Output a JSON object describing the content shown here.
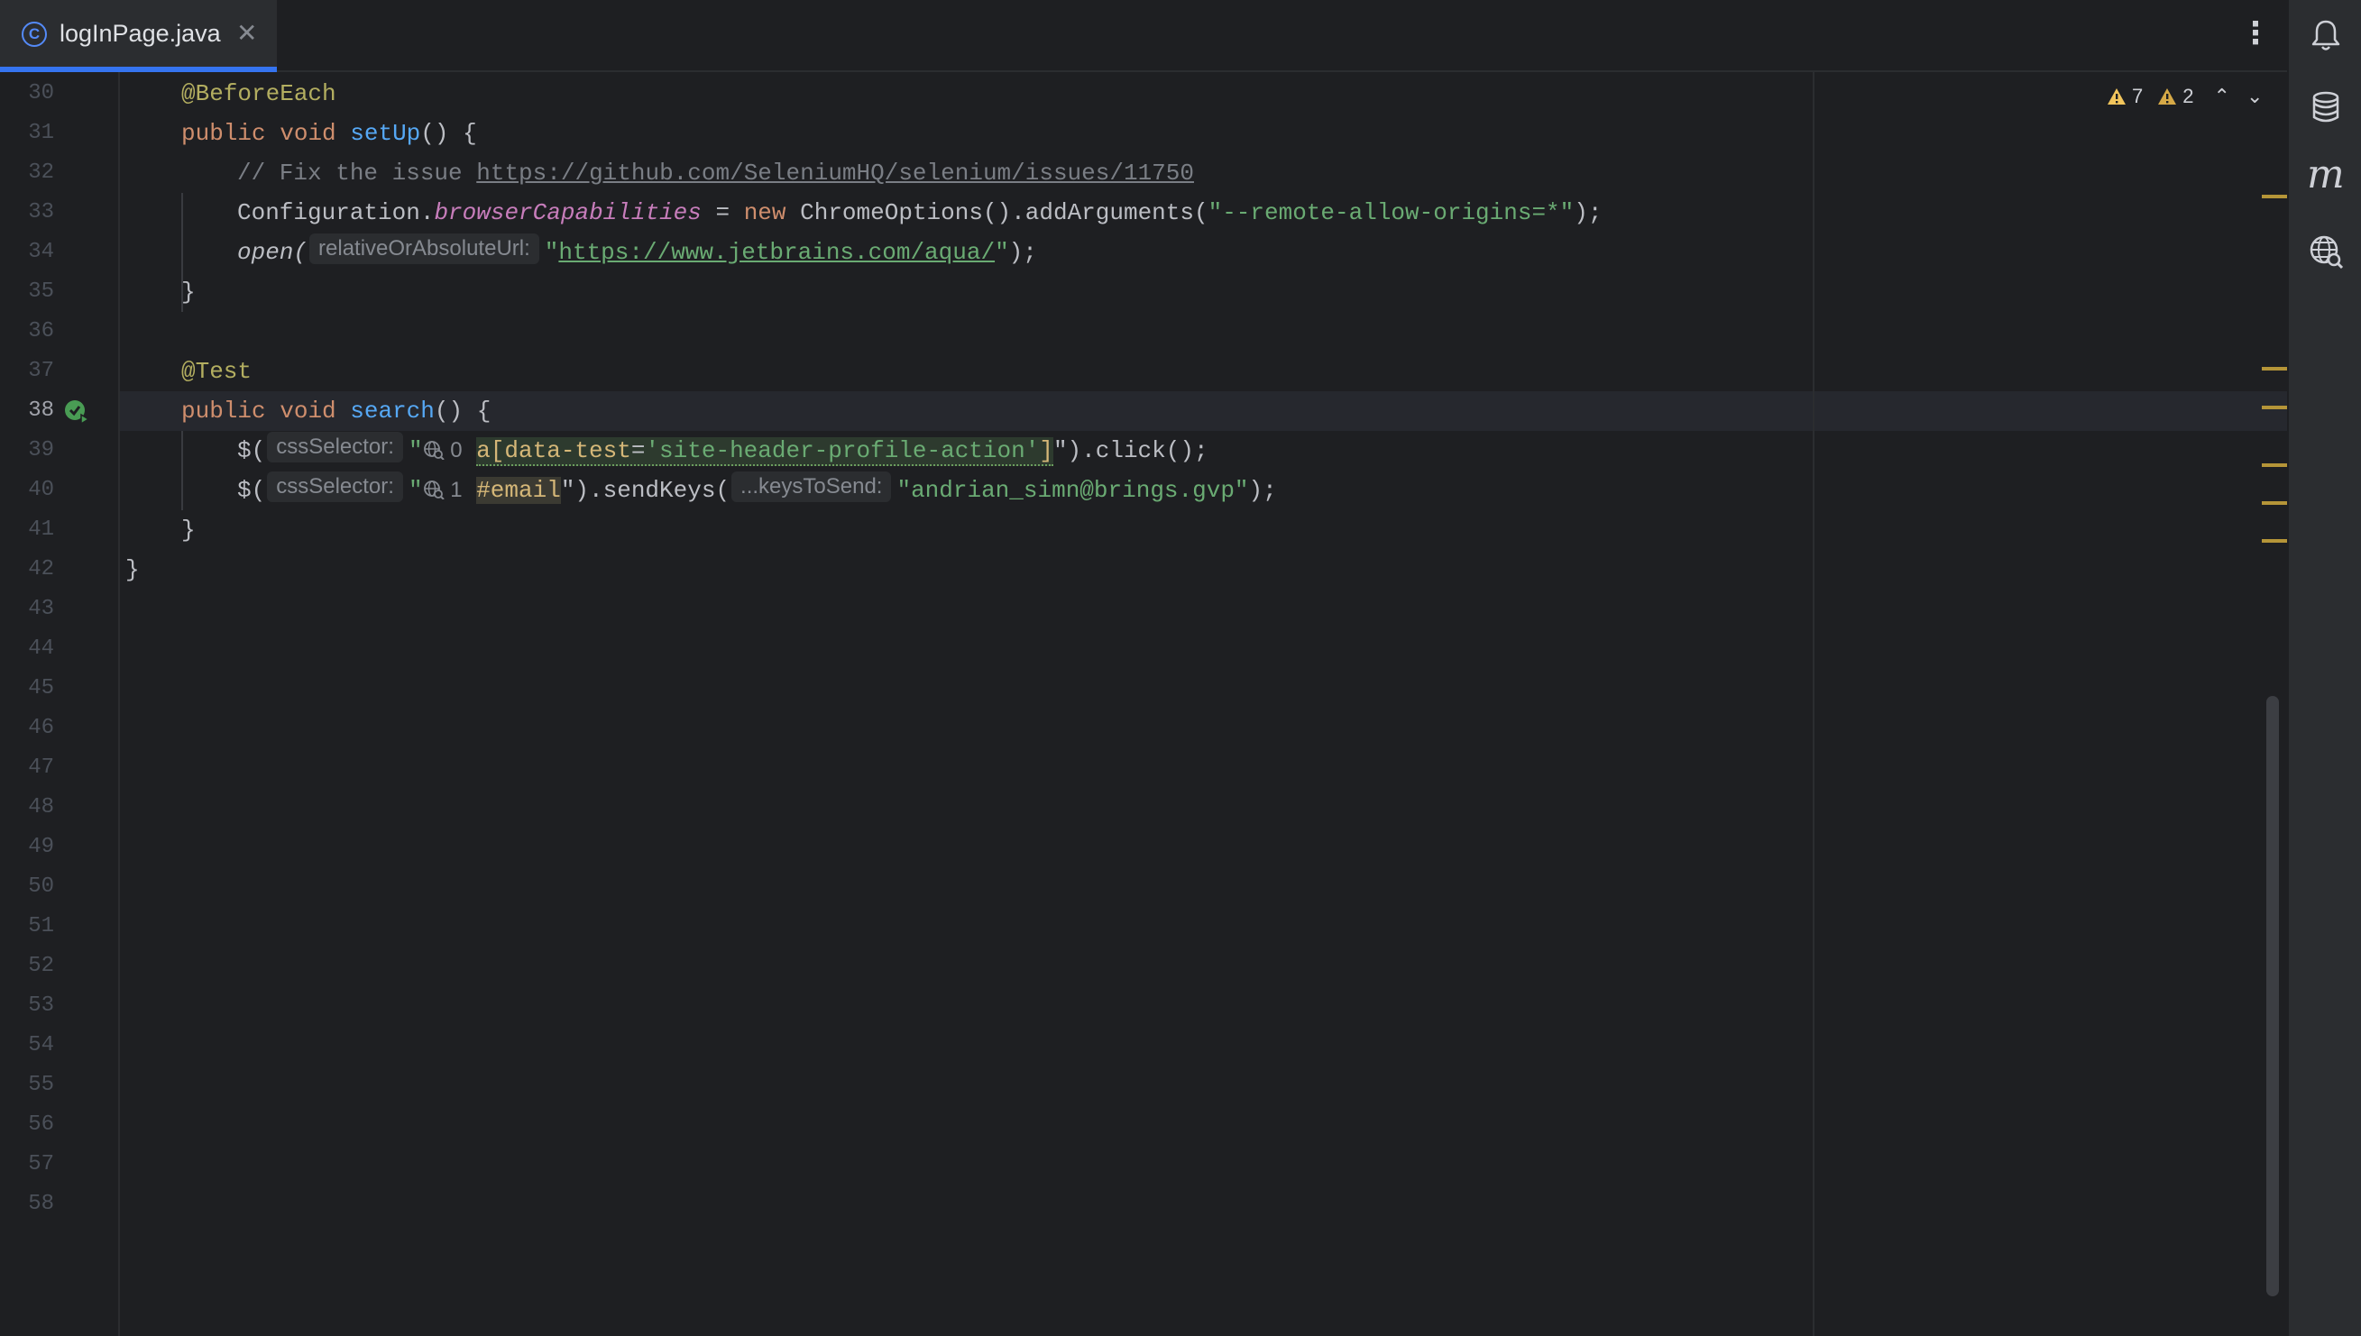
{
  "tab": {
    "title": "logInPage.java",
    "icon_letter": "C"
  },
  "inspections": {
    "warnings": "7",
    "weak_warnings": "2"
  },
  "line_numbers": [
    "30",
    "31",
    "32",
    "33",
    "34",
    "35",
    "36",
    "37",
    "38",
    "39",
    "40",
    "41",
    "42",
    "43",
    "44",
    "45",
    "46",
    "47",
    "48",
    "49",
    "50",
    "51",
    "52",
    "53",
    "54",
    "55",
    "56",
    "57",
    "58"
  ],
  "current_line": "38",
  "code": {
    "l30": {
      "annotation": "@BeforeEach"
    },
    "l31": {
      "kw1": "public",
      "kw2": "void",
      "fn": "setUp",
      "rest": "() {"
    },
    "l32": {
      "comment": "// Fix the issue ",
      "url": "https://github.com/SeleniumHQ/selenium/issues/11750"
    },
    "l33": {
      "cls": "Configuration.",
      "field": "browserCapabilities",
      "eq": " = ",
      "kw": "new",
      "call": " ChromeOptions().addArguments(",
      "str": "\"--remote-allow-origins=*\"",
      "end": ");"
    },
    "l34": {
      "fn": "open(",
      "hint": "relativeOrAbsoluteUrl:",
      "q1": "\"",
      "url": "https://www.jetbrains.com/aqua/",
      "q2": "\"",
      "end": ");"
    },
    "l35": {
      "brace": "}"
    },
    "l37": {
      "annotation": "@Test"
    },
    "l38": {
      "kw1": "public",
      "kw2": "void",
      "fn": "search",
      "rest": "() {"
    },
    "l39": {
      "start": "$(",
      "hint": "cssSelector:",
      "q1": "\"",
      "count": "0",
      "sel_a": "a[",
      "sel_attr": "data-test",
      "sel_eq": "=",
      "sel_val": "'site-header-profile-action'",
      "sel_close": "]",
      "end": "\").click();"
    },
    "l40": {
      "start": "$(",
      "hint": "cssSelector:",
      "q1": "\"",
      "count": "1",
      "sel": "#email",
      "mid": "\").sendKeys(",
      "hint2": "...keysToSend:",
      "str": "\"andrian_simn@brings.gvp\"",
      "end": ");"
    },
    "l41": {
      "brace": "}"
    },
    "l42": {
      "brace": "}"
    }
  },
  "colors": {
    "accent": "#3574f0",
    "keyword": "#cf8e6d",
    "string": "#6aab73",
    "function": "#56a8f5",
    "warning": "#f2c55c"
  }
}
